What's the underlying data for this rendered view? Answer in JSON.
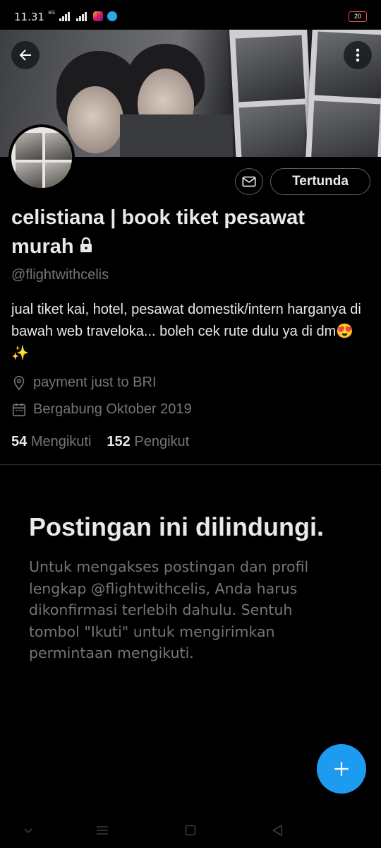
{
  "status_bar": {
    "time": "11.31",
    "network": "4G",
    "battery": "20",
    "battery_color": "#e25555"
  },
  "header": {
    "back_icon": "arrow-left-icon",
    "more_icon": "more-vertical-icon"
  },
  "profile": {
    "display_name": "celistiana | book tiket pesawat murah",
    "protected_icon": "lock-icon",
    "handle": "@flightwithcelis",
    "bio": "jual tiket kai, hotel, pesawat domestik/intern harganya di bawah web traveloka... boleh cek rute dulu ya di dm😍 ✨",
    "location": "payment just to BRI",
    "joined": "Bergabung Oktober 2019",
    "following_count": "54",
    "following_label": "Mengikuti",
    "followers_count": "152",
    "followers_label": "Pengikut",
    "pending_button": "Tertunda",
    "message_icon": "envelope-icon"
  },
  "protected_notice": {
    "title": "Postingan ini dilindungi.",
    "body": "Untuk mengakses postingan dan profil lengkap @flightwithcelis, Anda harus dikonfirmasi terlebih dahulu. Sentuh tombol \"Ikuti\" untuk mengirimkan permintaan mengikuti."
  },
  "fab": {
    "icon": "plus-icon",
    "color": "#1d9bf0"
  },
  "colors": {
    "background": "#000000",
    "primary_text": "#e7e9ea",
    "secondary_text": "#71767b",
    "border": "#536471"
  }
}
